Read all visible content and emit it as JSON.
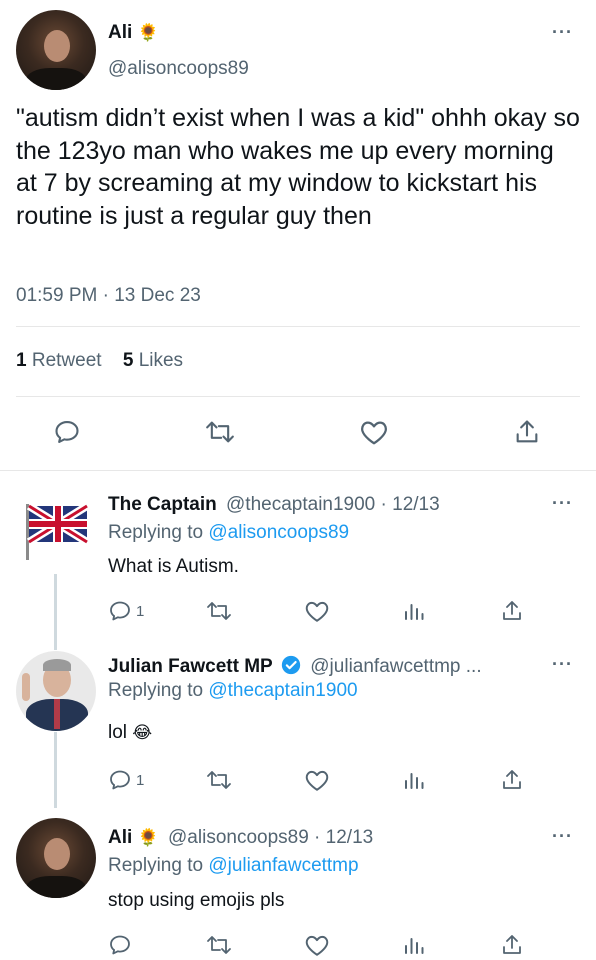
{
  "main_tweet": {
    "name": "Ali",
    "handle": "@alisoncoops89",
    "text": "\"autism didn’t exist when I was a kid\" ohhh okay so the 123yo man who wakes me up every morning at 7 by screaming at my window to kickstart his routine is just a regular guy then",
    "timestamp": "01:59 PM · 13 Dec 23",
    "retweet_count": "1",
    "retweet_label": "Retweet",
    "like_count": "5",
    "like_label": "Likes"
  },
  "replies": [
    {
      "name": "The Captain",
      "handle_date": "@thecaptain1900 · 12/13",
      "replying_prefix": "Replying to",
      "replying_to": "@alisoncoops89",
      "text": "What is Autism.",
      "reply_count": "1"
    },
    {
      "name": "Julian Fawcett MP",
      "handle_date": "@julianfawcettmp ...",
      "replying_prefix": "Replying to",
      "replying_to": "@thecaptain1900",
      "text": "lol",
      "reply_count": "1"
    },
    {
      "name": "Ali",
      "handle_date": "@alisoncoops89 · 12/13",
      "replying_prefix": "Replying to",
      "replying_to": "@julianfawcettmp",
      "text": "stop using emojis pls",
      "reply_count": ""
    }
  ],
  "emoji": {
    "sunflower": "🌻",
    "laughing": "😂"
  },
  "colors": {
    "link": "#1d9bf0",
    "muted": "#536471",
    "verified": "#1d9bf0"
  }
}
